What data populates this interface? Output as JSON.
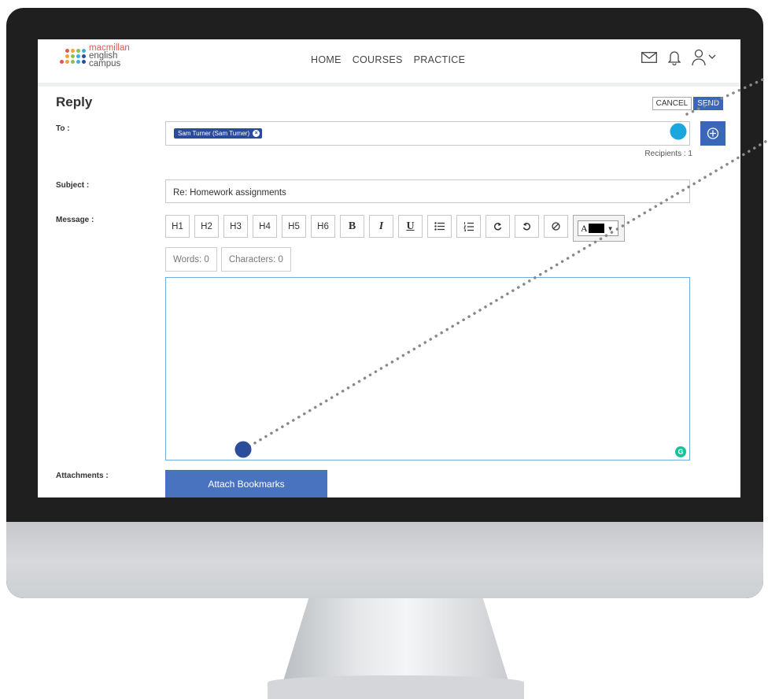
{
  "app": {
    "logo_lines": [
      "macmillan",
      "english",
      "campus"
    ],
    "logo_dot_colors": [
      "#e0574f",
      "#f2a33a",
      "#8cc152",
      "#3bafda",
      "#2b4e9b"
    ]
  },
  "nav": {
    "items": [
      "HOME",
      "COURSES",
      "PRACTICE"
    ]
  },
  "header_icons": [
    "mail-icon",
    "bell-icon",
    "user-menu-icon"
  ],
  "page": {
    "title": "Reply",
    "cancel_label": "CANCEL",
    "send_label": "SEND"
  },
  "form": {
    "to_label": "To :",
    "recipient_chip": "Sam Turner (Sam Turner)",
    "recipients_count": "Recipients : 1",
    "subject_label": "Subject :",
    "subject_value": "Re: Homework assignments",
    "message_label": "Message :",
    "attachments_label": "Attachments :",
    "attach_button": "Attach Bookmarks"
  },
  "toolbar": {
    "headings": [
      "H1",
      "H2",
      "H3",
      "H4",
      "H5",
      "H6"
    ],
    "format_buttons": [
      {
        "name": "bold-button",
        "label": "B",
        "style": "bold"
      },
      {
        "name": "italic-button",
        "label": "I",
        "style": "italic"
      },
      {
        "name": "underline-button",
        "label": "U",
        "style": "underline"
      }
    ],
    "list_icons": [
      "bulleted-list-icon",
      "numbered-list-icon"
    ],
    "history_icons": [
      "redo-icon",
      "undo-icon",
      "clear-format-icon"
    ],
    "color_letter": "A",
    "color_value": "#000000"
  },
  "counters": {
    "words": "Words: 0",
    "characters": "Characters: 0"
  },
  "colors": {
    "accent": "#3c66b7",
    "chip": "#2a4a9b",
    "callout_light": "#1aa6df",
    "callout_dark": "#2b4e9b",
    "grammarly": "#15c39a"
  }
}
